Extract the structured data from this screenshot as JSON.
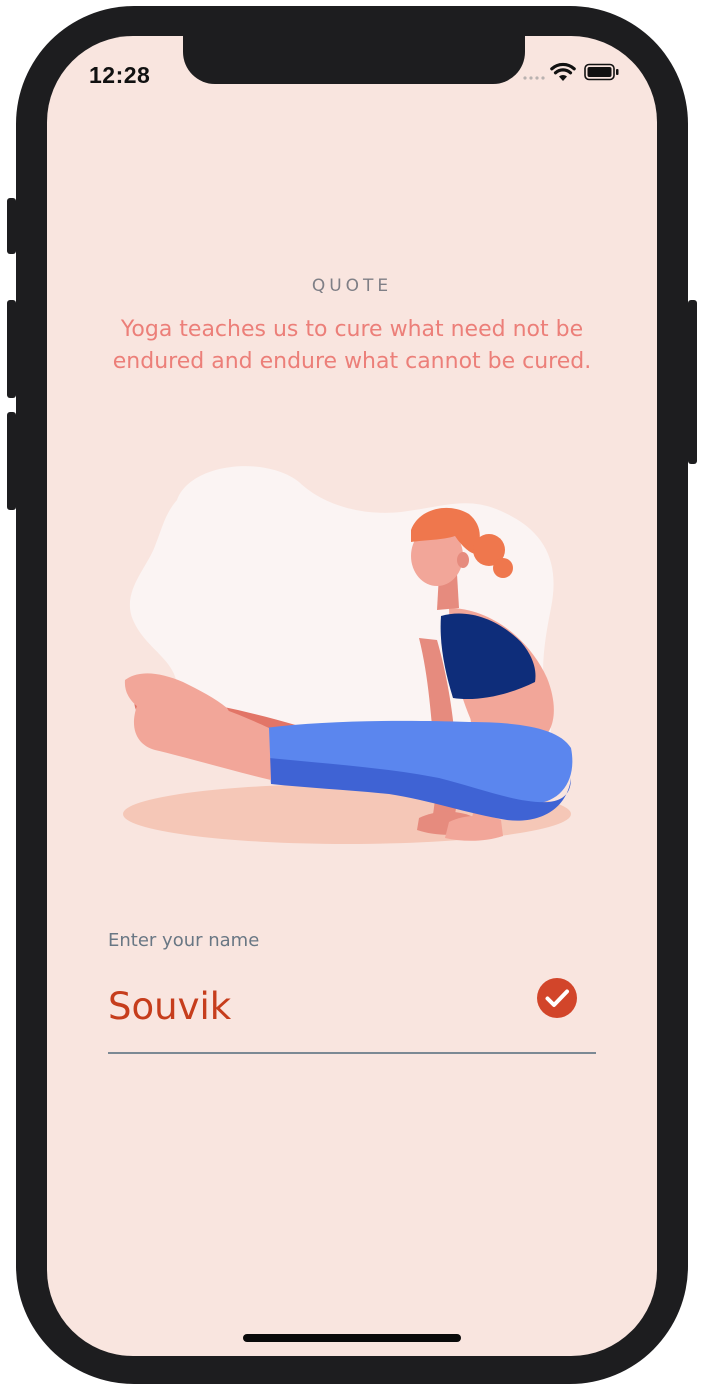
{
  "status_bar": {
    "time": "12:28"
  },
  "quote": {
    "label": "QUOTE",
    "text": "Yoga teaches us to cure what need not be endured and endure what cannot be cured."
  },
  "name_field": {
    "label": "Enter your name",
    "value": "Souvik"
  },
  "colors": {
    "background": "#f9e5df",
    "quote_text": "#ec7f79",
    "input_text": "#c63d1c",
    "accent": "#d2452a"
  },
  "icons": [
    "signal-icon",
    "wifi-icon",
    "battery-icon",
    "check-circle-icon"
  ]
}
